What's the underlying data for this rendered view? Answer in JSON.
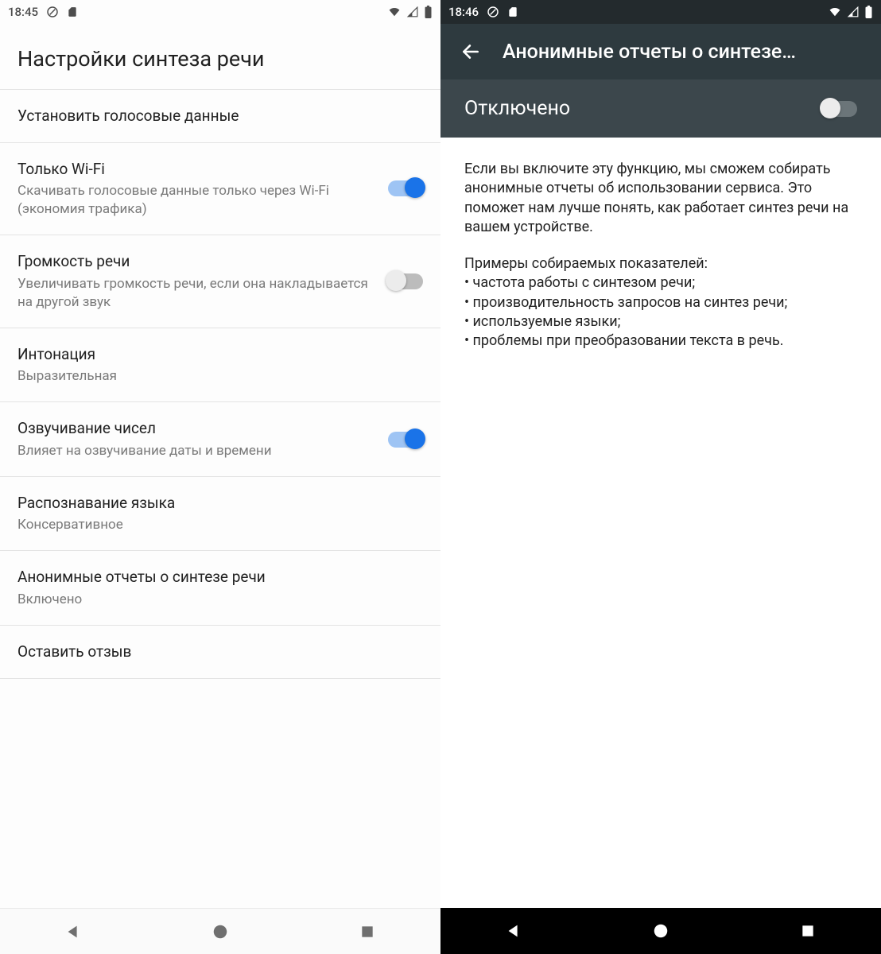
{
  "left": {
    "status_time": "18:45",
    "header": "Настройки синтеза речи",
    "rows": {
      "install": {
        "title": "Установить голосовые данные"
      },
      "wifi": {
        "title": "Только Wi-Fi",
        "sub": "Скачивать голосовые данные только через Wi-Fi (экономия трафика)",
        "on": true
      },
      "volume": {
        "title": "Громкость речи",
        "sub": "Увеличивать громкость речи, если она накладывается на другой звук",
        "on": false
      },
      "inton": {
        "title": "Интонация",
        "sub": "Выразительная"
      },
      "numbers": {
        "title": "Озвучивание чисел",
        "sub": "Влияет на озвучивание даты и времени",
        "on": true
      },
      "lang": {
        "title": "Распознавание языка",
        "sub": "Консервативное"
      },
      "reports": {
        "title": "Анонимные отчеты о синтезе речи",
        "sub": "Включено"
      },
      "feedback": {
        "title": "Оставить отзыв"
      }
    }
  },
  "right": {
    "status_time": "18:46",
    "appbar_title": "Анонимные отчеты о синтезе…",
    "toggle_label": "Отключено",
    "toggle_on": false,
    "paragraph": "Если вы включите эту функцию, мы сможем собирать анонимные отчеты об использовании сервиса. Это поможет нам лучше понять, как работает синтез речи на вашем устройстве.",
    "list_intro": "Примеры собираемых показателей:",
    "bullets": [
      "• частота работы с синтезом речи;",
      "• производительность запросов на синтез речи;",
      "• используемые языки;",
      "• проблемы при преобразовании текста в речь."
    ]
  }
}
